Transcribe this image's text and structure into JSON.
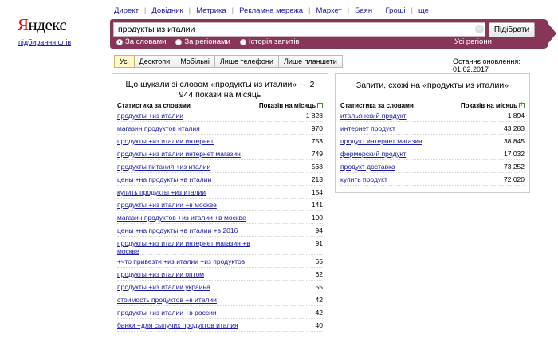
{
  "logo": {
    "brand_first": "Я",
    "brand_rest": "ндекс",
    "subtitle": "підбирання слів"
  },
  "topnav": [
    "Директ",
    "Довідник",
    "Метрика",
    "Рекламна мережа",
    "Маркет",
    "Баян",
    "Гроші",
    "ще"
  ],
  "search": {
    "value": "продукты из италии",
    "button": "Підібрати"
  },
  "radios": {
    "by_words": "За словами",
    "by_regions": "За регіонами",
    "history": "Історія запитів",
    "all_regions": "Усі регіони"
  },
  "tabs": [
    "Усі",
    "Десктопи",
    "Мобільні",
    "Лише телефони",
    "Лише планшети"
  ],
  "updated": "Останнє оновлення: 01.02.2017",
  "left_panel": {
    "title": "Що шукали зі словом «продукты из италии» — 2 944 покази на місяць",
    "col_words": "Статистика за словами",
    "col_shows": "Показів на місяць",
    "rows": [
      {
        "phrase": "продукты +из италии",
        "count": "1 828"
      },
      {
        "phrase": "магазин продуктов италия",
        "count": "970"
      },
      {
        "phrase": "продукты +из италии интернет",
        "count": "753"
      },
      {
        "phrase": "продукты +из италии интернет магазин",
        "count": "749"
      },
      {
        "phrase": "продукты питания +из италии",
        "count": "568"
      },
      {
        "phrase": "цены +на продукты +в италии",
        "count": "213"
      },
      {
        "phrase": "купить продукты +из италии",
        "count": "154"
      },
      {
        "phrase": "продукты +из италии +в москве",
        "count": "141"
      },
      {
        "phrase": "магазин продуктов +из италии +в москве",
        "count": "100"
      },
      {
        "phrase": "цены +на продукты +в италии +в 2016",
        "count": "94"
      },
      {
        "phrase": "продукты +из италии интернет магазин +в москве",
        "count": "91"
      },
      {
        "phrase": "+что привезти +из италии +из продуктов",
        "count": "65"
      },
      {
        "phrase": "продукты +из италии оптом",
        "count": "62"
      },
      {
        "phrase": "продукты +из италии украина",
        "count": "55"
      },
      {
        "phrase": "стоимость продуктов +в италии",
        "count": "42"
      },
      {
        "phrase": "продукты +из италии +в россии",
        "count": "42"
      },
      {
        "phrase": "банки +для сыпучих продуктов италия",
        "count": "40"
      }
    ]
  },
  "right_panel": {
    "title": "Запити, схожі на «продукты из италии»",
    "col_words": "Статистика за словами",
    "col_shows": "Показів на місяць",
    "rows": [
      {
        "phrase": "итальянский продукт",
        "count": "1 894"
      },
      {
        "phrase": "интернет продукт",
        "count": "43 283"
      },
      {
        "phrase": "продукт интернет магазин",
        "count": "38 845"
      },
      {
        "phrase": "фермерский продукт",
        "count": "17 032"
      },
      {
        "phrase": "продукт доставка",
        "count": "73 252"
      },
      {
        "phrase": "купить продукт",
        "count": "72 020"
      }
    ]
  }
}
